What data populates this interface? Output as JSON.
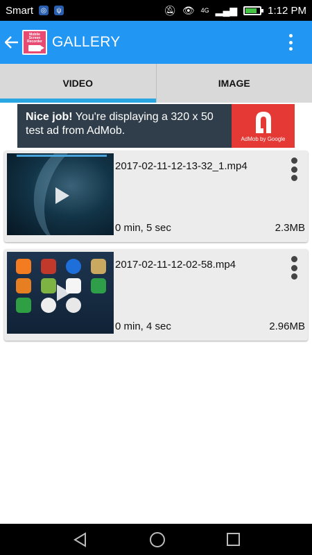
{
  "status_bar": {
    "carrier": "Smart",
    "network": "4G",
    "time": "1:12 PM",
    "battery_level": 0.7
  },
  "app_bar": {
    "title": "GALLERY",
    "logo_text": "Mobile Screen Recorder"
  },
  "tabs": [
    {
      "label": "VIDEO",
      "active": true
    },
    {
      "label": "IMAGE",
      "active": false
    }
  ],
  "ad": {
    "headline": "Nice job!",
    "body": " You're displaying a 320 x 50 test ad from AdMob.",
    "logo_caption": "AdMob by Google"
  },
  "videos": [
    {
      "file_name": "2017-02-11-12-13-32_1.mp4",
      "duration": "0 min, 5 sec",
      "size": "2.3MB"
    },
    {
      "file_name": "2017-02-11-12-02-58.mp4",
      "duration": "0 min, 4 sec",
      "size": "2.96MB"
    }
  ],
  "colors": {
    "primary": "#2196f3",
    "tab_indicator": "#2aa7e2",
    "ad_background": "#2f3e4a",
    "ad_logo": "#e53935"
  }
}
